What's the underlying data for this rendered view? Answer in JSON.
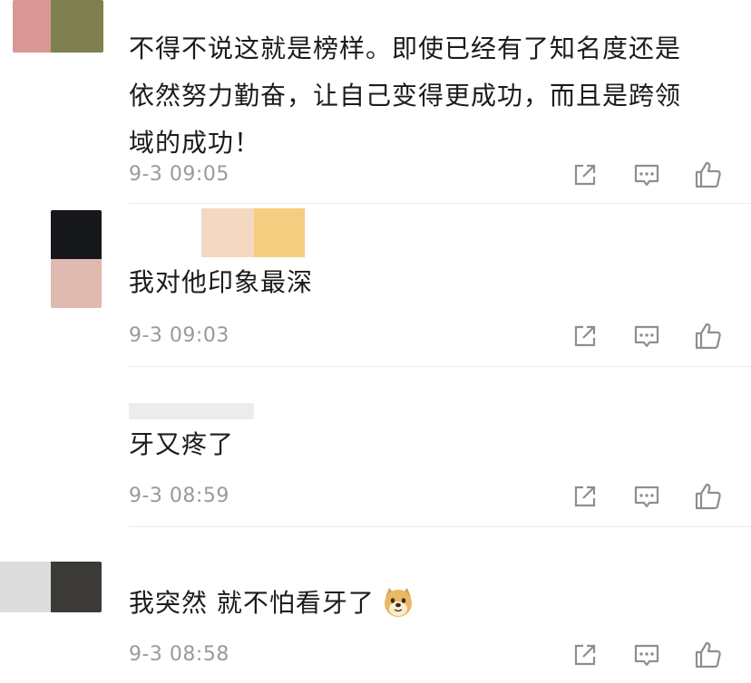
{
  "comments": [
    {
      "text_line1": "不得不说这就是榜样。即使已经有了知名度还是",
      "text_line2": "依然努力勤奋，让自己变得更成功，而且是跨领",
      "text_line3": "域的成功！",
      "time": "9-3 09:05"
    },
    {
      "text": "我对他印象最深",
      "time": "9-3 09:03"
    },
    {
      "text": "牙又疼了",
      "time": "9-3 08:59"
    },
    {
      "text": "我突然 就不怕看牙了",
      "time": "9-3 08:58"
    }
  ],
  "icons": {
    "share": "share-icon",
    "reply": "reply-icon",
    "like": "thumbs-up-icon",
    "emoji": "doge-emoji-icon"
  },
  "colors": {
    "text": "#1b1b1b",
    "timestamp": "#9a9a9a",
    "icon": "#8e8e8e",
    "divider": "#ececec"
  }
}
